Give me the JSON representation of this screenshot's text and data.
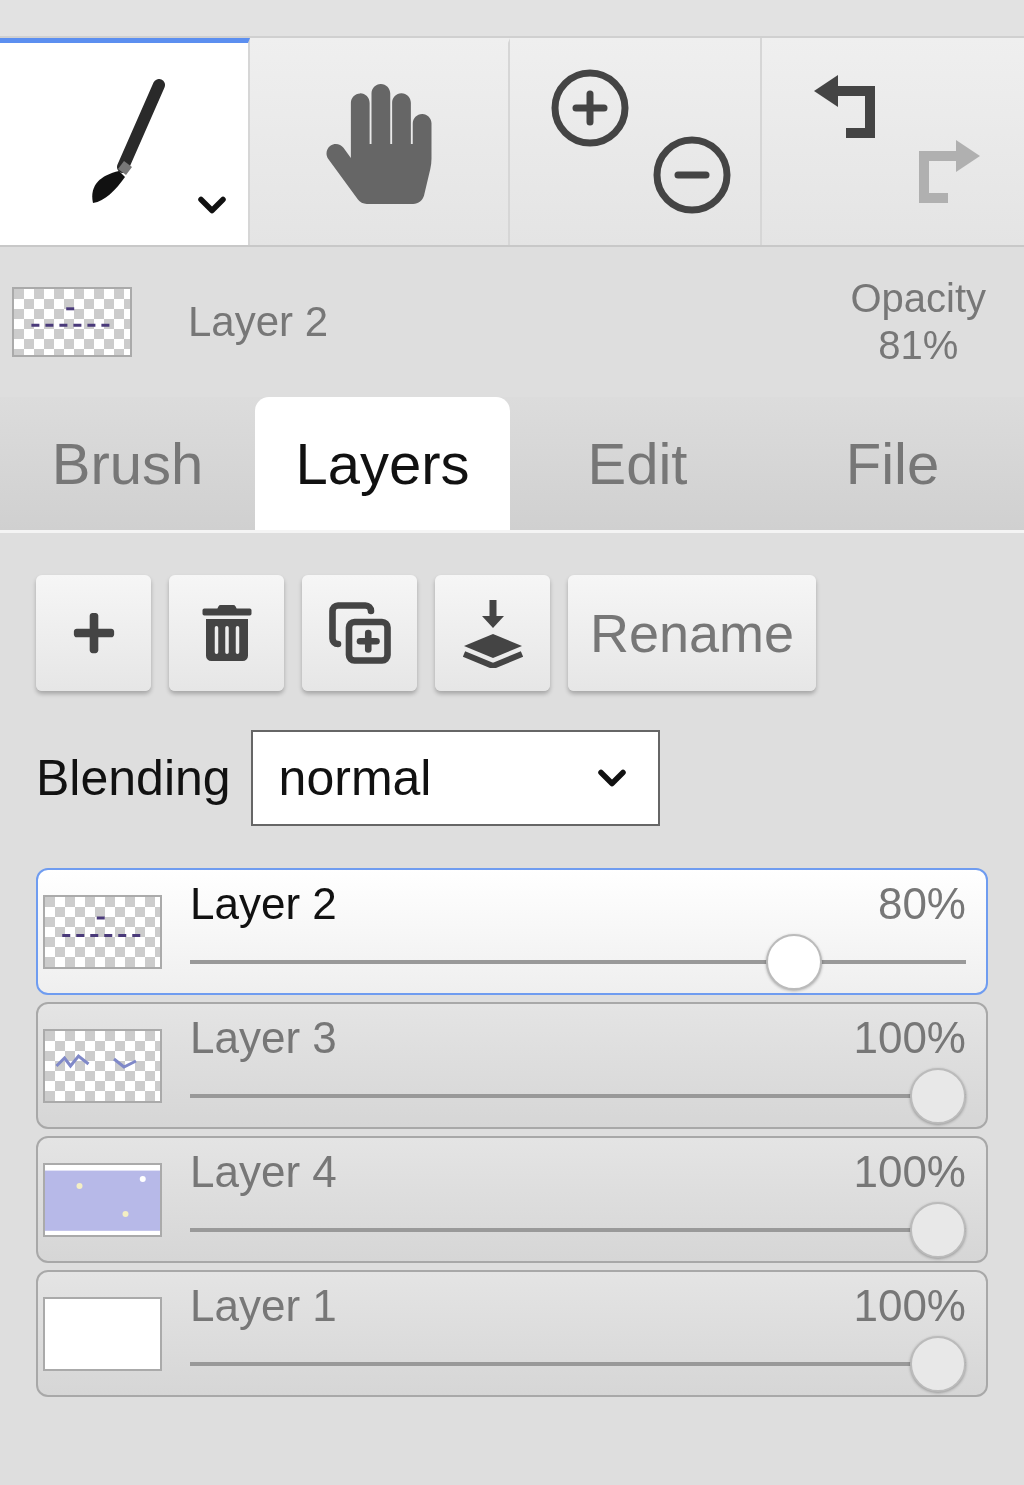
{
  "toolbar": {
    "tools": [
      {
        "kind": "brush",
        "selected": true
      },
      {
        "kind": "hand",
        "selected": false
      }
    ],
    "history": {
      "undo_disabled": false,
      "redo_disabled": true
    }
  },
  "current_layer": {
    "thumbnail": {
      "kind": "strokes"
    },
    "name": "Layer 2",
    "opacity_label": "Opacity",
    "opacity_value": "81%"
  },
  "tabs": [
    {
      "label": "Brush",
      "selected": false
    },
    {
      "label": "Layers",
      "selected": true
    },
    {
      "label": "Edit",
      "selected": false
    },
    {
      "label": "File",
      "selected": false
    }
  ],
  "layer_actions": {
    "rename": "Rename"
  },
  "blending": {
    "label": "Blending",
    "value": "normal"
  },
  "layers": [
    {
      "name": "Layer 2",
      "opacity": "80%",
      "level": 0.8,
      "selected": true,
      "thumbnail": {
        "kind": "strokes"
      }
    },
    {
      "name": "Layer 3",
      "opacity": "100%",
      "level": 1,
      "selected": false,
      "thumbnail": {
        "kind": "scribble"
      }
    },
    {
      "name": "Layer 4",
      "opacity": "100%",
      "level": 1,
      "selected": false,
      "thumbnail": {
        "kind": "lavender"
      }
    },
    {
      "name": "Layer 1",
      "opacity": "100%",
      "level": 1,
      "selected": false,
      "thumbnail": {
        "kind": "white"
      }
    }
  ]
}
